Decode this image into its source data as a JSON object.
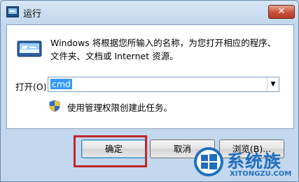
{
  "window": {
    "title": "运行",
    "close_glyph": "✕"
  },
  "description": {
    "line1": "Windows 将根据您所输入的名称，为您打开相应的程序、",
    "line2": "文件夹、文档或 Internet 资源。"
  },
  "open_field": {
    "label": "打开(O):",
    "value": "cmd",
    "dropdown_glyph": "▼"
  },
  "admin_note": "使用管理权限创建此任务。",
  "buttons": {
    "ok": "确定",
    "cancel": "取消",
    "browse": "浏览(B)..."
  },
  "watermark": {
    "text": "系统族",
    "url": "XITONGZU.COM"
  },
  "icons": {
    "title": "run-icon",
    "run": "run-program-icon",
    "shield": "uac-shield-icon",
    "watermark": "windows-logo-icon"
  },
  "colors": {
    "highlight_box": "#c1252b",
    "selection": "#3399ff",
    "close_button": "#c9503a",
    "watermark": "#1f6fbf"
  }
}
